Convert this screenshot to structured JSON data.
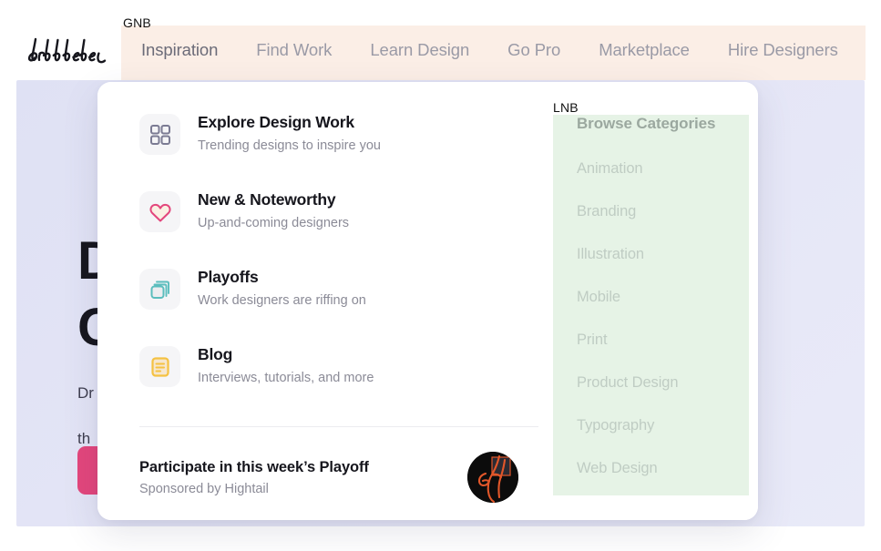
{
  "brand": {
    "logo_text": "dribbble",
    "accent_pink": "#e3467c"
  },
  "annotations": {
    "gnb": "GNB",
    "lnb": "LNB"
  },
  "nav": {
    "items": [
      {
        "label": "Inspiration",
        "active": true
      },
      {
        "label": "Find Work",
        "active": false
      },
      {
        "label": "Learn Design",
        "active": false
      },
      {
        "label": "Go Pro",
        "active": false
      },
      {
        "label": "Marketplace",
        "active": false
      },
      {
        "label": "Hire Designers",
        "active": false
      }
    ]
  },
  "hero": {
    "title_line1": "D",
    "title_line2": "C",
    "sub_line1": "Dr",
    "sub_line2": "th",
    "cta_label": ""
  },
  "dropdown": {
    "menu": [
      {
        "icon": "grid-icon",
        "title": "Explore Design Work",
        "desc": "Trending designs to inspire you"
      },
      {
        "icon": "heart-icon",
        "title": "New & Noteworthy",
        "desc": "Up-and-coming designers"
      },
      {
        "icon": "stacked-squares-icon",
        "title": "Playoffs",
        "desc": "Work designers are riffing on"
      },
      {
        "icon": "document-icon",
        "title": "Blog",
        "desc": "Interviews, tutorials, and more"
      }
    ],
    "sponsor": {
      "title": "Participate in this week’s Playoff",
      "subtitle": "Sponsored by Hightail",
      "avatar": "hand-illustration-avatar"
    },
    "categories": {
      "heading": "Browse Categories",
      "items": [
        "Animation",
        "Branding",
        "Illustration",
        "Mobile",
        "Print",
        "Product Design",
        "Typography",
        "Web Design"
      ]
    }
  },
  "colors": {
    "gnb_band": "#fbeee6",
    "lnb_band": "#d6ecd6",
    "hero_bg": "#e4e5f6",
    "icon_grid": "#7b7b93",
    "icon_heart": "#e3467c",
    "icon_playoffs": "#5bbdbd",
    "icon_blog": "#f5c242"
  }
}
